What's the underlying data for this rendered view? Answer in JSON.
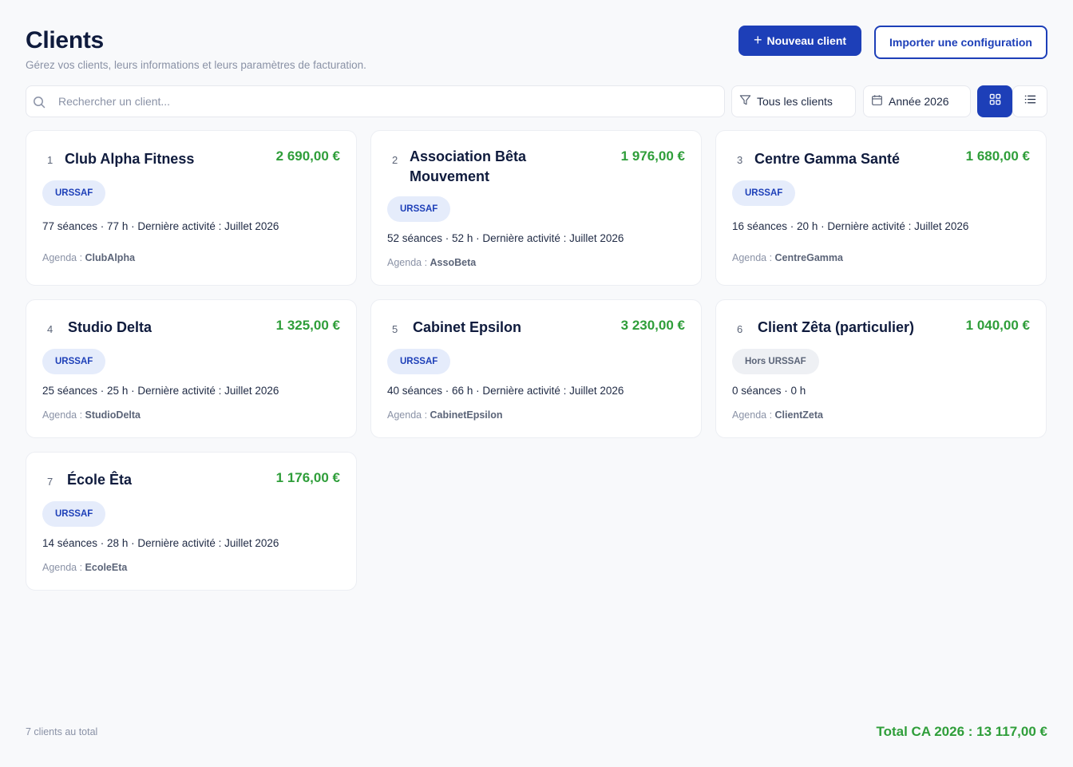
{
  "header": {
    "title": "Clients",
    "subtitle": "Gérez vos clients, leurs informations et leurs paramètres de facturation."
  },
  "actions": {
    "new_client": "Nouveau client",
    "import_config": "Importer une configuration"
  },
  "toolbar": {
    "search_placeholder": "Rechercher un client...",
    "filter_clients": "Tous les clients",
    "filter_year": "Année 2026"
  },
  "agenda_label": "Agenda :",
  "clients": [
    {
      "index": "1",
      "name": "Club Alpha Fitness",
      "amount": "2 690,00 €",
      "badge": "URSSAF",
      "stats": "77 séances  ·  77 h  ·  Dernière activité : Juillet 2026",
      "agenda": "ClubAlpha"
    },
    {
      "index": "2",
      "name": "Association Bêta Mouvement",
      "amount": "1 976,00 €",
      "badge": "URSSAF",
      "stats": "52 séances  ·  52 h  ·  Dernière activité : Juillet 2026",
      "agenda": "AssoBeta"
    },
    {
      "index": "3",
      "name": "Centre Gamma Santé",
      "amount": "1 680,00 €",
      "badge": "URSSAF",
      "stats": "16 séances  ·  20 h  ·  Dernière activité : Juillet 2026",
      "agenda": "CentreGamma"
    },
    {
      "index": "4",
      "name": "Studio Delta",
      "amount": "1 325,00 €",
      "badge": "URSSAF",
      "stats": "25 séances  ·  25 h  ·  Dernière activité : Juillet 2026",
      "agenda": "StudioDelta"
    },
    {
      "index": "5",
      "name": "Cabinet Epsilon",
      "amount": "3 230,00 €",
      "badge": "URSSAF",
      "stats": "40 séances  ·  66 h  ·  Dernière activité : Juillet 2026",
      "agenda": "CabinetEpsilon"
    },
    {
      "index": "6",
      "name": "Client Zêta (particulier)",
      "amount": "1 040,00 €",
      "badge": "Hors URSSAF",
      "stats": "0 séances  ·  0 h",
      "agenda": "ClientZeta"
    },
    {
      "index": "7",
      "name": "École Êta",
      "amount": "1 176,00 €",
      "badge": "URSSAF",
      "stats": "14 séances  ·  28 h  ·  Dernière activité : Juillet 2026",
      "agenda": "EcoleEta"
    }
  ],
  "footer": {
    "count": "7 clients au total",
    "total": "Total CA 2026 : 13 117,00 €"
  },
  "colors": {
    "primary": "#1d3fb8",
    "amount_green": "#2f9e3a",
    "badge_bg": "#e5ecfb",
    "badge_neutral_bg": "#eef0f4",
    "page_bg": "#f8f9fb"
  },
  "icons": {
    "search": "search-icon",
    "filter": "filter-icon",
    "calendar": "calendar-icon",
    "grid": "grid-view-icon",
    "list": "list-view-icon",
    "plus": "plus-icon"
  }
}
